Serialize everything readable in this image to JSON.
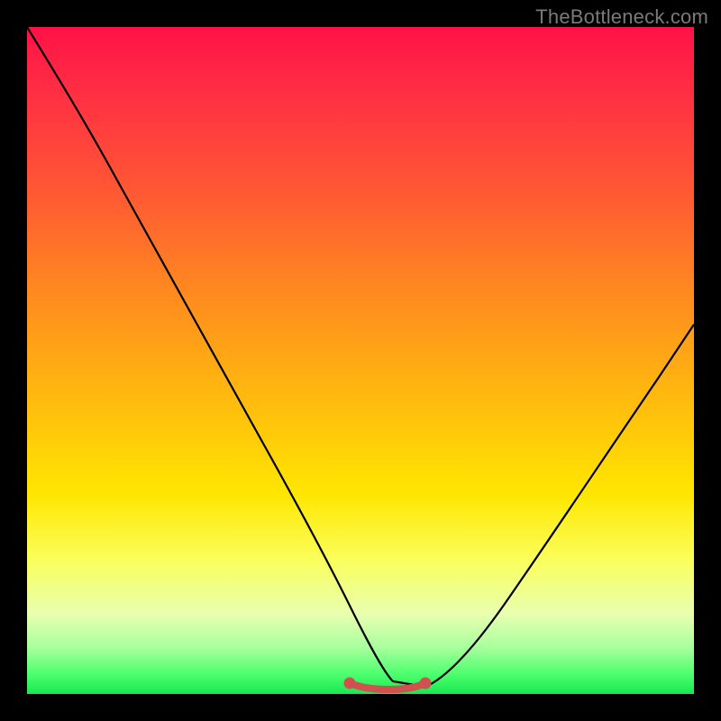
{
  "watermark": "TheBottleneck.com",
  "chart_data": {
    "type": "line",
    "title": "",
    "xlabel": "",
    "ylabel": "",
    "xlim": [
      0,
      100
    ],
    "ylim": [
      0,
      100
    ],
    "grid": false,
    "legend": false,
    "series": [
      {
        "name": "black-curve",
        "color": "#000000",
        "x": [
          0,
          5,
          10,
          15,
          20,
          25,
          30,
          35,
          40,
          45,
          48,
          50,
          53,
          58,
          60,
          65,
          70,
          75,
          80,
          85,
          90,
          95,
          100
        ],
        "y": [
          100,
          90,
          80,
          70,
          60.5,
          51,
          41.5,
          32,
          22.5,
          13,
          6,
          2,
          0.5,
          0.5,
          2,
          8,
          15,
          22,
          29,
          36,
          43,
          50,
          57
        ]
      },
      {
        "name": "red-flat-segment",
        "color": "#d9534f",
        "x": [
          48,
          50,
          53,
          56,
          58,
          60
        ],
        "y": [
          1.2,
          0.8,
          0.7,
          0.7,
          0.9,
          1.8
        ]
      }
    ],
    "annotations": [
      {
        "type": "dot",
        "x": 48,
        "y": 1.2,
        "color": "#d9534f"
      },
      {
        "type": "dot",
        "x": 60,
        "y": 1.8,
        "color": "#d9534f"
      }
    ]
  }
}
